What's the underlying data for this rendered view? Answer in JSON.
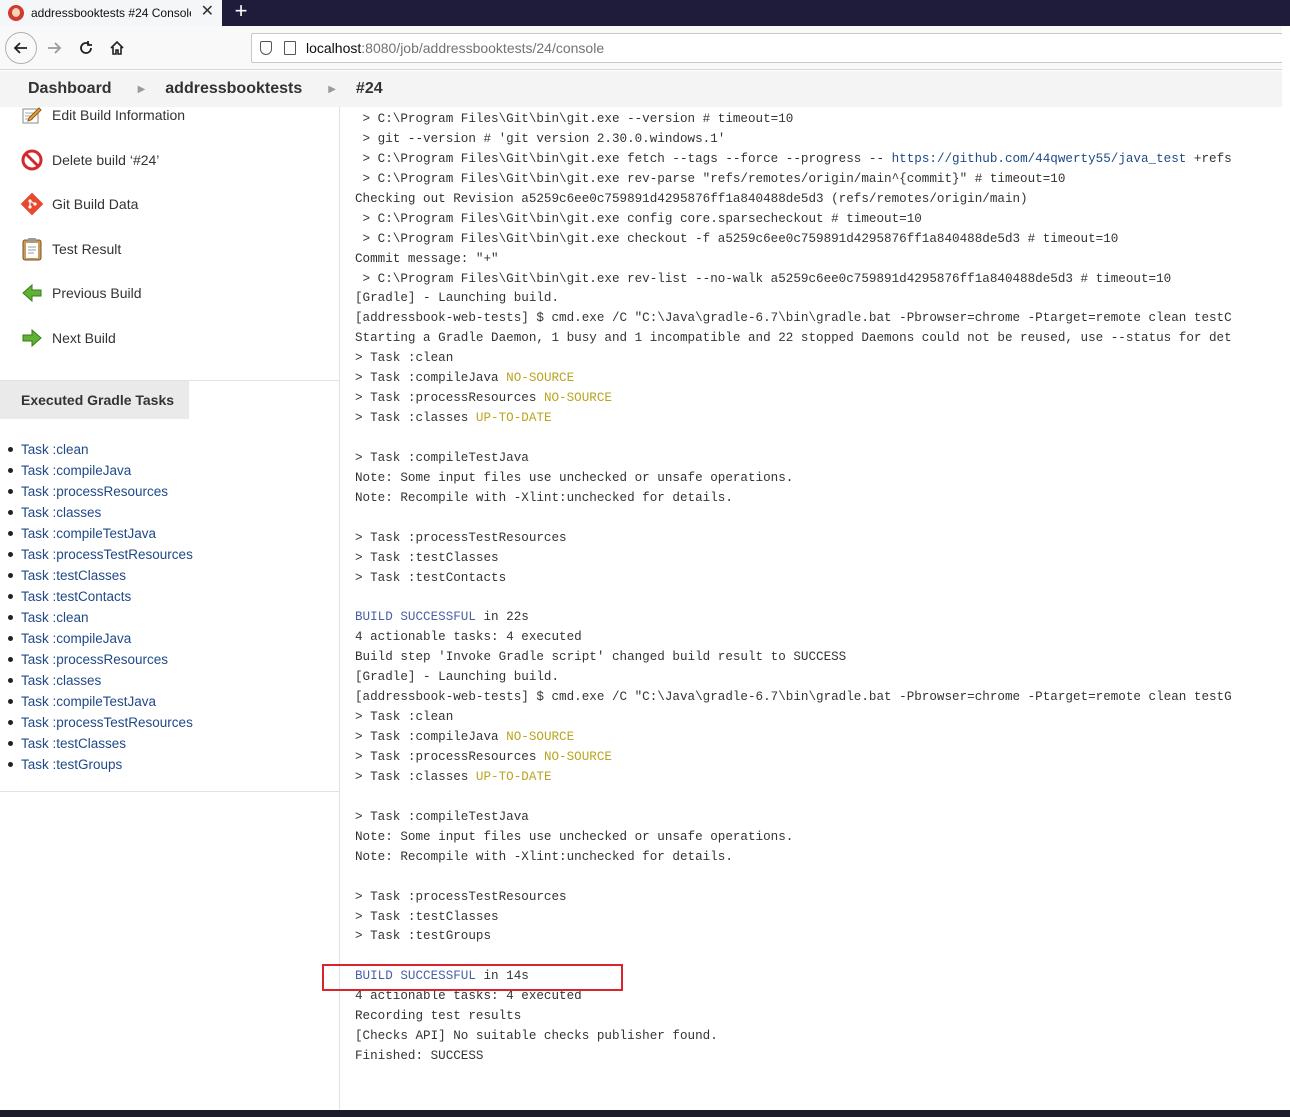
{
  "browser": {
    "tab_title": "addressbooktests #24 Console [",
    "tab_close": "✕",
    "new_tab": "+",
    "url_host": "localhost",
    "url_rest": ":8080/job/addressbooktests/24/console"
  },
  "breadcrumb": [
    "Dashboard",
    "addressbooktests",
    "#24"
  ],
  "sidebar": {
    "tasks": [
      {
        "label": "Edit Build Information",
        "icon": "edit-notepad-icon"
      },
      {
        "label": "Delete build ‘#24’",
        "icon": "no-entry-icon"
      },
      {
        "label": "Git Build Data",
        "icon": "git-icon"
      },
      {
        "label": "Test Result",
        "icon": "clipboard-icon"
      },
      {
        "label": "Previous Build",
        "icon": "green-arrow-left-icon"
      },
      {
        "label": "Next Build",
        "icon": "green-arrow-right-icon"
      }
    ],
    "gradle_header": "Executed Gradle Tasks",
    "gradle_tasks": [
      "Task :clean",
      "Task :compileJava",
      "Task :processResources",
      "Task :classes",
      "Task :compileTestJava",
      "Task :processTestResources",
      "Task :testClasses",
      "Task :testContacts",
      "Task :clean",
      "Task :compileJava",
      "Task :processResources",
      "Task :classes",
      "Task :compileTestJava",
      "Task :processTestResources",
      "Task :testClasses",
      "Task :testGroups"
    ]
  },
  "console": [
    {
      "text": " > C:\\Program Files\\Git\\bin\\git.exe --version # timeout=10"
    },
    {
      "text": " > git --version # 'git version 2.30.0.windows.1'"
    },
    {
      "text": " > C:\\Program Files\\Git\\bin\\git.exe fetch --tags --force --progress -- ",
      "link": "https://github.com/44qwerty55/java_test",
      "after": " +refs"
    },
    {
      "text": " > C:\\Program Files\\Git\\bin\\git.exe rev-parse \"refs/remotes/origin/main^{commit}\" # timeout=10"
    },
    {
      "text": "Checking out Revision a5259c6ee0c759891d4295876ff1a840488de5d3 (refs/remotes/origin/main)"
    },
    {
      "text": " > C:\\Program Files\\Git\\bin\\git.exe config core.sparsecheckout # timeout=10"
    },
    {
      "text": " > C:\\Program Files\\Git\\bin\\git.exe checkout -f a5259c6ee0c759891d4295876ff1a840488de5d3 # timeout=10"
    },
    {
      "text": "Commit message: \"+\""
    },
    {
      "text": " > C:\\Program Files\\Git\\bin\\git.exe rev-list --no-walk a5259c6ee0c759891d4295876ff1a840488de5d3 # timeout=10"
    },
    {
      "text": "[Gradle] - Launching build."
    },
    {
      "text": "[addressbook-web-tests] $ cmd.exe /C \"C:\\Java\\gradle-6.7\\bin\\gradle.bat -Pbrowser=chrome -Ptarget=remote clean testC"
    },
    {
      "text": "Starting a Gradle Daemon, 1 busy and 1 incompatible and 22 stopped Daemons could not be reused, use --status for det"
    },
    {
      "text": "> Task :clean"
    },
    {
      "text": "> Task :compileJava ",
      "warn": "NO-SOURCE"
    },
    {
      "text": "> Task :processResources ",
      "warn": "NO-SOURCE"
    },
    {
      "text": "> Task :classes ",
      "warn": "UP-TO-DATE"
    },
    {
      "text": ""
    },
    {
      "text": "> Task :compileTestJava"
    },
    {
      "text": "Note: Some input files use unchecked or unsafe operations."
    },
    {
      "text": "Note: Recompile with -Xlint:unchecked for details."
    },
    {
      "text": ""
    },
    {
      "text": "> Task :processTestResources"
    },
    {
      "text": "> Task :testClasses"
    },
    {
      "text": "> Task :testContacts"
    },
    {
      "text": ""
    },
    {
      "ok": "BUILD SUCCESSFUL",
      "text": " in 22s"
    },
    {
      "text": "4 actionable tasks: 4 executed"
    },
    {
      "text": "Build step 'Invoke Gradle script' changed build result to SUCCESS"
    },
    {
      "text": "[Gradle] - Launching build."
    },
    {
      "text": "[addressbook-web-tests] $ cmd.exe /C \"C:\\Java\\gradle-6.7\\bin\\gradle.bat -Pbrowser=chrome -Ptarget=remote clean testG"
    },
    {
      "text": "> Task :clean"
    },
    {
      "text": "> Task :compileJava ",
      "warn": "NO-SOURCE"
    },
    {
      "text": "> Task :processResources ",
      "warn": "NO-SOURCE"
    },
    {
      "text": "> Task :classes ",
      "warn": "UP-TO-DATE"
    },
    {
      "text": ""
    },
    {
      "text": "> Task :compileTestJava"
    },
    {
      "text": "Note: Some input files use unchecked or unsafe operations."
    },
    {
      "text": "Note: Recompile with -Xlint:unchecked for details."
    },
    {
      "text": ""
    },
    {
      "text": "> Task :processTestResources"
    },
    {
      "text": "> Task :testClasses"
    },
    {
      "text": "> Task :testGroups"
    },
    {
      "text": ""
    },
    {
      "ok": "BUILD SUCCESSFUL",
      "text": " in 14s"
    },
    {
      "text": "4 actionable tasks: 4 executed"
    },
    {
      "text": "Recording test results"
    },
    {
      "text": "[Checks API] No suitable checks publisher found."
    },
    {
      "text": "Finished: SUCCESS"
    }
  ],
  "colors": {
    "ok": "#4a5fa8",
    "warn": "#b9a520",
    "link": "#204a87",
    "highlight": "#d9242b"
  }
}
